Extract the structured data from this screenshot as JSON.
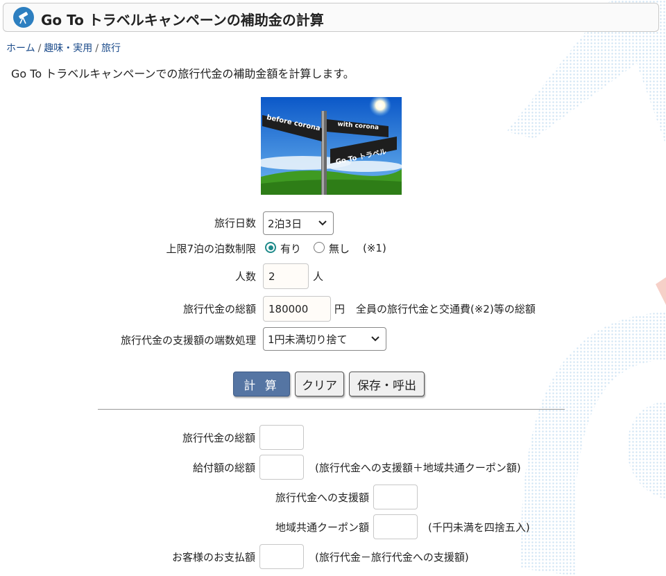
{
  "title": "Go To トラベルキャンペーンの補助金の計算",
  "breadcrumb": [
    "ホーム",
    "趣味・実用",
    "旅行"
  ],
  "description": "Go To トラベルキャンペーンでの旅行代金の補助金額を計算します。",
  "hero_image": {
    "sign_left": "before corona",
    "sign_right_top": "with corona",
    "sign_right_bottom": "Go To トラベル"
  },
  "form": {
    "days": {
      "label": "旅行日数",
      "value": "2泊3日"
    },
    "limit": {
      "label": "上限7泊の泊数制限",
      "option_yes": "有り",
      "option_no": "無し",
      "note": "(※1)",
      "selected": "有り"
    },
    "people": {
      "label": "人数",
      "value": "2",
      "unit": "人"
    },
    "total": {
      "label": "旅行代金の総額",
      "value": "180000",
      "unit": "円",
      "note": "全員の旅行代金と交通費(※2)等の総額"
    },
    "rounding": {
      "label": "旅行代金の支援額の端数処理",
      "value": "1円未満切り捨て"
    }
  },
  "buttons": {
    "calc": "計 算",
    "clear": "クリア",
    "save": "保存・呼出"
  },
  "results": {
    "total": {
      "label": "旅行代金の総額",
      "value": ""
    },
    "benefit": {
      "label": "給付額の総額",
      "value": "",
      "note": "(旅行代金への支援額＋地域共通クーポン額)"
    },
    "support": {
      "label": "旅行代金への支援額",
      "value": ""
    },
    "coupon": {
      "label": "地域共通クーポン額",
      "value": "",
      "note": "(千円未満を四捨五入)"
    },
    "payment": {
      "label": "お客様のお支払額",
      "value": "",
      "note": "(旅行代金－旅行代金への支援額)"
    }
  },
  "colors": {
    "accent": "#5575a3",
    "radio": "#1f8a8a",
    "link": "#1a4a8a"
  }
}
